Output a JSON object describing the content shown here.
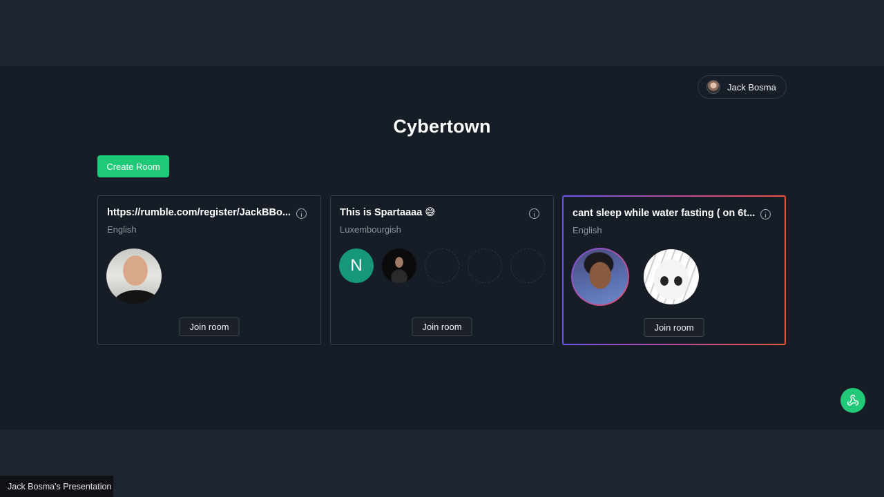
{
  "user": {
    "name": "Jack Bosma"
  },
  "page": {
    "title": "Cybertown"
  },
  "actions": {
    "create_room": "Create Room"
  },
  "rooms": [
    {
      "title": "https://rumble.com/register/JackBBo...",
      "language": "English",
      "join_label": "Join room",
      "participants": [
        "photo-avatar"
      ]
    },
    {
      "title": "This is Spartaaaa 😅",
      "language": "Luxembourgish",
      "join_label": "Join room",
      "participants": [
        "N",
        "photo-avatar"
      ],
      "empty_slots": 3
    },
    {
      "title": "cant sleep while water fasting ( on 6t...",
      "language": "English",
      "join_label": "Join room",
      "participants": [
        "photo-avatar",
        "anime-avatar"
      ],
      "highlighted": true
    }
  ],
  "fab": {
    "icon": "webhook-icon"
  },
  "footer": {
    "presenter_label": "Jack Bosma's Presentation"
  },
  "colors": {
    "accent": "#1ec977",
    "background": "#171d26",
    "highlight_gradient": [
      "#6a55f0",
      "#ee5443"
    ]
  }
}
